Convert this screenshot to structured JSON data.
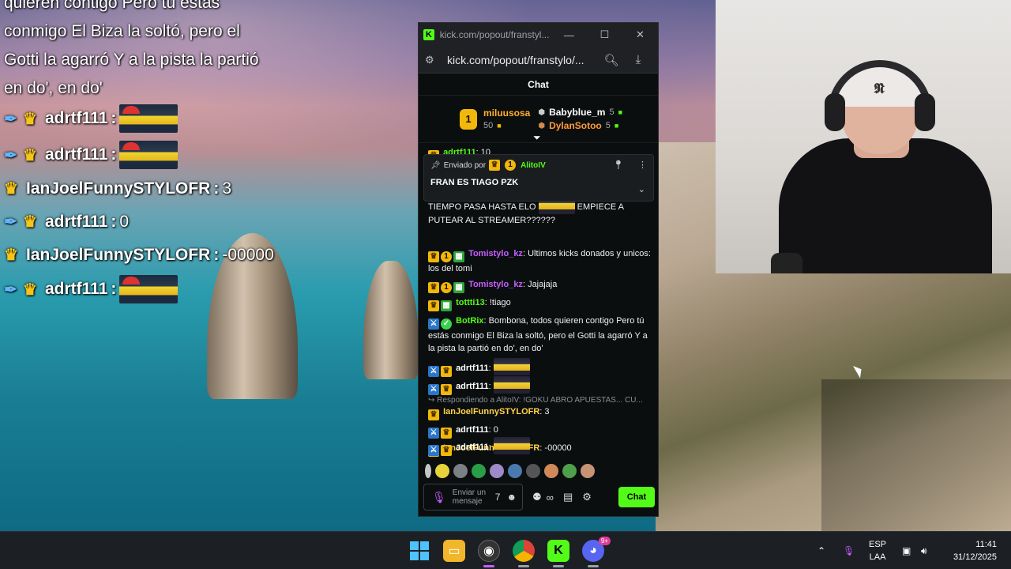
{
  "overlay": {
    "lyric_lines": [
      "quieren contigo Pero tú estás",
      "conmigo El Biza la soltó, pero el",
      "Gotti la agarró Y a la pista la partió",
      "en do', en do'"
    ],
    "messages": [
      {
        "user": "adrtf111",
        "sep": ":",
        "text": ""
      },
      {
        "user": "adrtf111",
        "sep": ":",
        "text": ""
      },
      {
        "user": "IanJoelFunnySTYLOFR",
        "sep": ":",
        "text": "3"
      },
      {
        "user": "adrtf111",
        "sep": ":",
        "text": "0"
      },
      {
        "user": "IanJoelFunnySTYLOFR",
        "sep": ":",
        "text": "-00000"
      },
      {
        "user": "adrtf111",
        "sep": ":",
        "text": ""
      }
    ]
  },
  "window": {
    "title": "kick.com/popout/franstyl...",
    "url": "kick.com/popout/franstylo/..."
  },
  "chat": {
    "header": "Chat",
    "top_gifters": [
      {
        "rank": "1",
        "name": "miluusosa",
        "count": "50"
      },
      {
        "name": "Babyblue_m",
        "count": "5"
      },
      {
        "name": "DylanSotoo",
        "count": "5"
      }
    ],
    "pinned": {
      "label": "Enviado por",
      "badge_num": "1",
      "user": "AlitoIV",
      "message": "FRAN ES TIAGO PZK"
    },
    "messages": [
      {
        "user": "adrtf111",
        "text": "10"
      },
      {
        "text": "TIEMPO PASA HASTA",
        "extra": "ELO",
        "tail": "EMPIECE A PUTEAR AL STREAMER??????"
      },
      {
        "user": "Tomistylo_kz",
        "text": "Ultimos kicks donados y unicos: los del tomi"
      },
      {
        "user": "Tomistylo_kz",
        "text": "Jajajaja"
      },
      {
        "user": "tottti13",
        "text": "!tiago"
      },
      {
        "user": "BotRix",
        "text": "Bombona, todos quieren contigo Pero tú estás conmigo El Biza la soltó, pero el Gotti la agarró Y a la pista la partió en do', en do'"
      },
      {
        "user": "adrtf111",
        "text": ""
      },
      {
        "user": "adrtf111",
        "text": ""
      },
      {
        "reply": "Respondiendo a AlitoIV: !GOKU ABRO APUESTAS... CU..."
      },
      {
        "user": "IanJoelFunnySTYLOFR",
        "text": "3"
      },
      {
        "user": "adrtf111",
        "text": "0"
      },
      {
        "user": "IanJoelFunnySTYLOFR",
        "text": "-00000"
      },
      {
        "user": "adrtf111",
        "text": ""
      }
    ],
    "input_placeholder": "Enviar un mensaje",
    "send_label": "Chat"
  },
  "taskbar": {
    "discord_badge": "9+",
    "lang_1": "ESP",
    "lang_2": "LAA",
    "time": "11:41",
    "date": "31/12/2025"
  },
  "colors": {
    "kick_green": "#53fc18",
    "crown_gold": "#f2b70b",
    "gifter_orange": "#ff9a3c",
    "tomi_purple": "#c65eff"
  }
}
